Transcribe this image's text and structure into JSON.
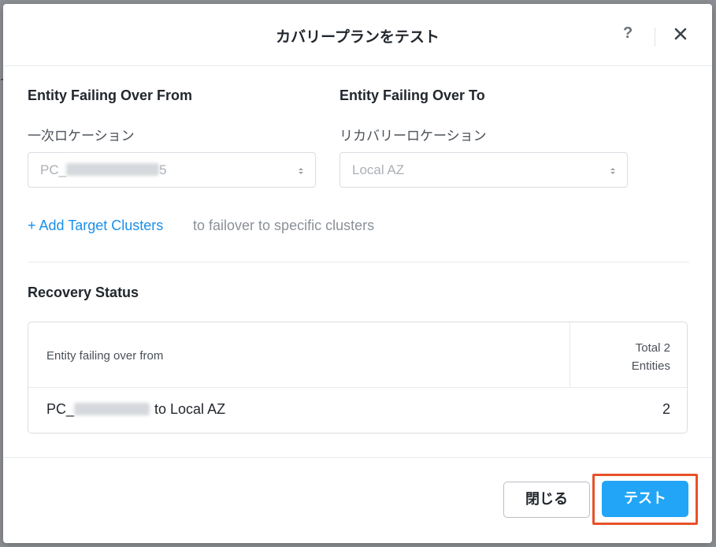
{
  "background": {
    "edge_glyph": "て"
  },
  "dialog": {
    "title": "カバリープランをテスト",
    "help_label": "?",
    "close_icon": "close-icon"
  },
  "from": {
    "heading": "Entity Failing Over From",
    "sublabel": "一次ロケーション",
    "select_value_prefix": "PC_",
    "select_value_suffix": "5"
  },
  "to": {
    "heading": "Entity Failing Over To",
    "sublabel": "リカバリーロケーション",
    "select_value": "Local AZ"
  },
  "add_target": {
    "link_label": "+ Add Target Clusters",
    "note": "to failover to specific clusters"
  },
  "recovery": {
    "heading": "Recovery Status",
    "table": {
      "col_left_header": "Entity failing over from",
      "col_right_header_line1": "Total 2",
      "col_right_header_line2": "Entities",
      "rows": [
        {
          "prefix": "PC_",
          "suffix": "to Local AZ",
          "count": "2"
        }
      ]
    }
  },
  "footer": {
    "close_button": "閉じる",
    "test_button": "テスト"
  },
  "colors": {
    "accent": "#22a5f7",
    "link": "#1b8fe8",
    "highlight": "#e8522a",
    "overlay": "#8c8f93"
  }
}
